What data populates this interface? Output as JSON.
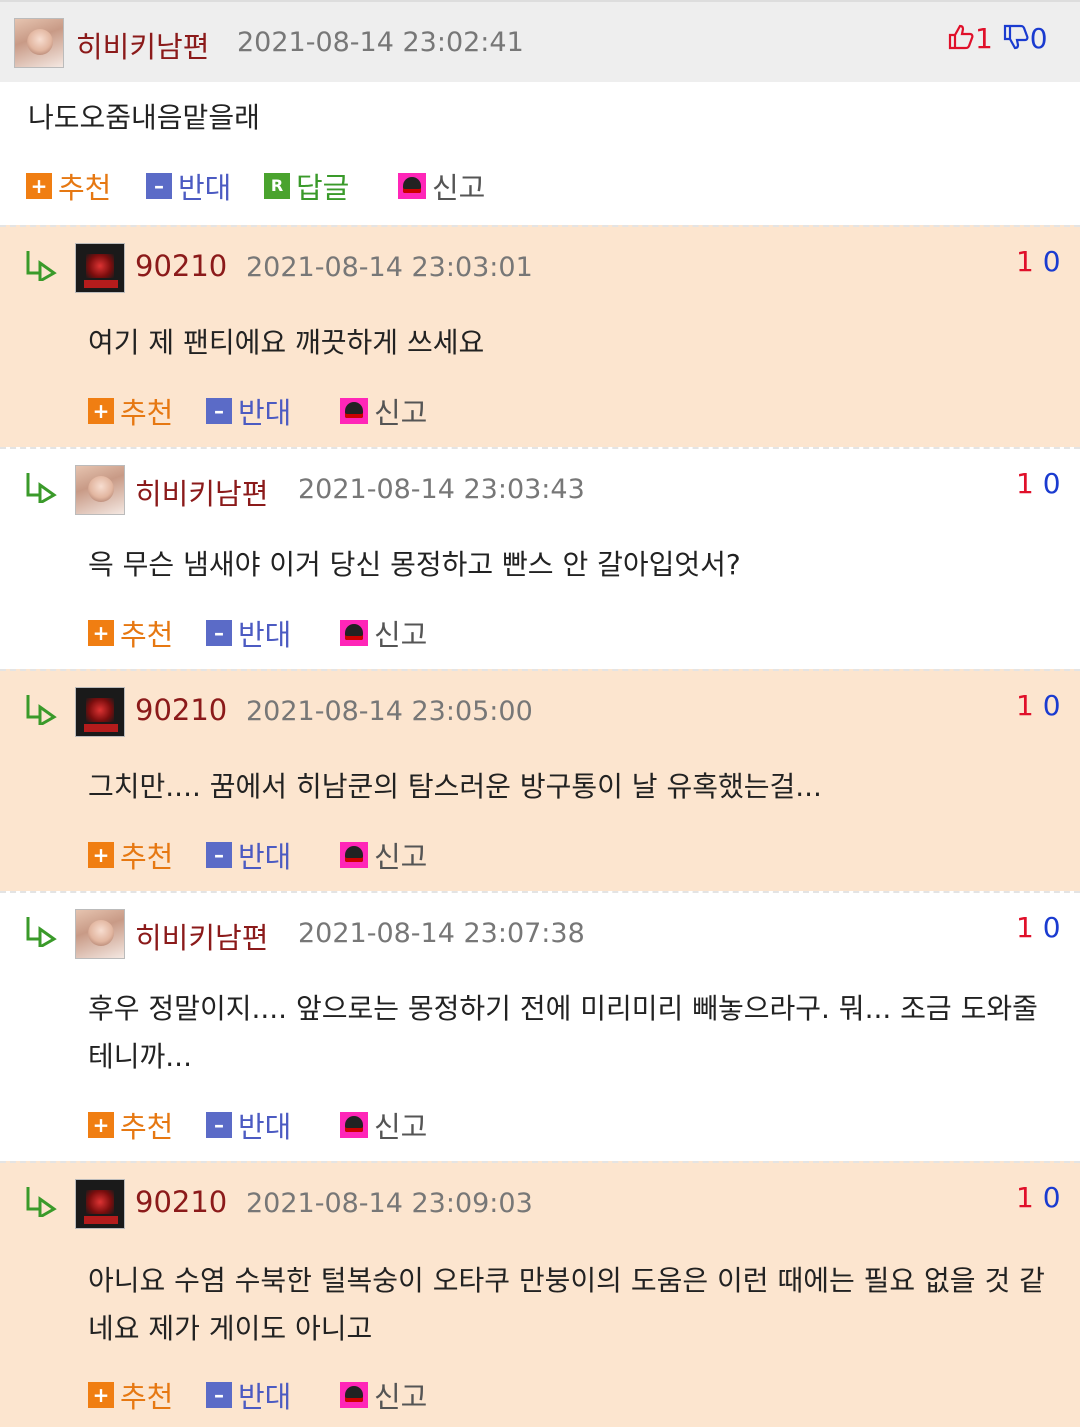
{
  "top": {
    "nickname": "히비키남편",
    "date": "2021-08-14 23:02:41",
    "up_count": "1",
    "down_count": "0",
    "text": "나도오줌내음맡을래",
    "actions": {
      "recommend": "추천",
      "oppose": "반대",
      "reply": "답글",
      "report": "신고"
    }
  },
  "replies": [
    {
      "nickname": "90210",
      "date": "2021-08-14 23:03:01",
      "up": "1",
      "down": "0",
      "text": "여기 제 팬티에요 깨끗하게 쓰세요"
    },
    {
      "nickname": "히비키남편",
      "date": "2021-08-14 23:03:43",
      "up": "1",
      "down": "0",
      "text": "윽 무슨 냄새야 이거 당신 몽정하고 빤스 안 갈아입엇서?"
    },
    {
      "nickname": "90210",
      "date": "2021-08-14 23:05:00",
      "up": "1",
      "down": "0",
      "text": "그치만.... 꿈에서 히남쿤의 탐스러운 방구통이 날 유혹했는걸..."
    },
    {
      "nickname": "히비키남편",
      "date": "2021-08-14 23:07:38",
      "up": "1",
      "down": "0",
      "text": "후우 정말이지.... 앞으로는 몽정하기 전에 미리미리 빼놓으라구. 뭐... 조금 도와줄테니까..."
    },
    {
      "nickname": "90210",
      "date": "2021-08-14 23:09:03",
      "up": "1",
      "down": "0",
      "text": "아니요 수염 수북한 털복숭이 오타쿠 만붕이의 도움은 이런 때에는 필요 없을 것 같네요 제가 게이도 아니고"
    }
  ],
  "reply_actions": {
    "recommend": "추천",
    "oppose": "반대",
    "report": "신고"
  },
  "colors": {
    "peach": "#fce5cf",
    "nick": "#8b1a1a",
    "up": "#e0102a",
    "down": "#1a3bd0"
  }
}
